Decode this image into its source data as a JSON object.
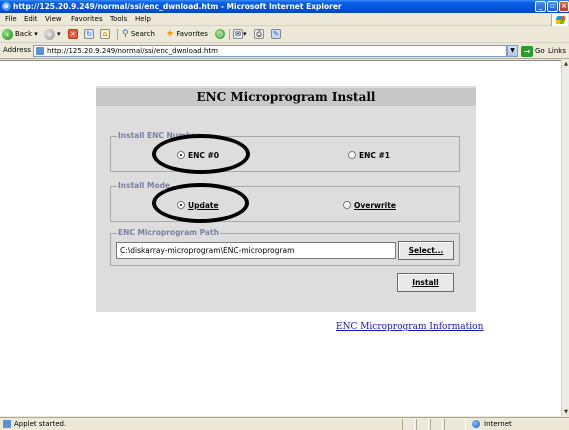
{
  "window": {
    "title": "http://125.20.9.249/normal/ssi/enc_dwnload.htm - Microsoft Internet Explorer",
    "buttons": {
      "minimize": "_",
      "maximize": "▫",
      "close": "×"
    }
  },
  "menu": [
    "File",
    "Edit",
    "View",
    "Favorites",
    "Tools",
    "Help"
  ],
  "toolbar": {
    "back_label": "Back",
    "search_label": "Search",
    "favorites_label": "Favorites"
  },
  "address_bar": {
    "label": "Address",
    "url": "http://125.20.9.249/normal/ssi/enc_dwnload.htm",
    "go_label": "Go",
    "links_label": "Links"
  },
  "page": {
    "title": "ENC Microprogram Install",
    "install_enc_number": {
      "legend": "Install ENC Number",
      "options": [
        "ENC #0",
        "ENC #1"
      ],
      "selected": "ENC #0"
    },
    "install_mode": {
      "legend": "Install Mode",
      "options": [
        "Update",
        "Overwrite"
      ],
      "selected": "Update"
    },
    "path": {
      "legend": "ENC Microprogram Path",
      "value": "C:\\diskarray-microprogram\\ENC-microprogram",
      "select_label": "Select..."
    },
    "install_label": "Install",
    "info_link": "ENC Microprogram Information"
  },
  "status_bar": {
    "text": "Applet started.",
    "zone": "Internet"
  },
  "colors": {
    "titlebar": "#0552d8",
    "panel_bg": "#dddddd",
    "panel_header_bg": "#c8c8c8",
    "legend_text": "#7b80a0",
    "link": "#1414c8",
    "annotation_ellipse": "#000000"
  }
}
